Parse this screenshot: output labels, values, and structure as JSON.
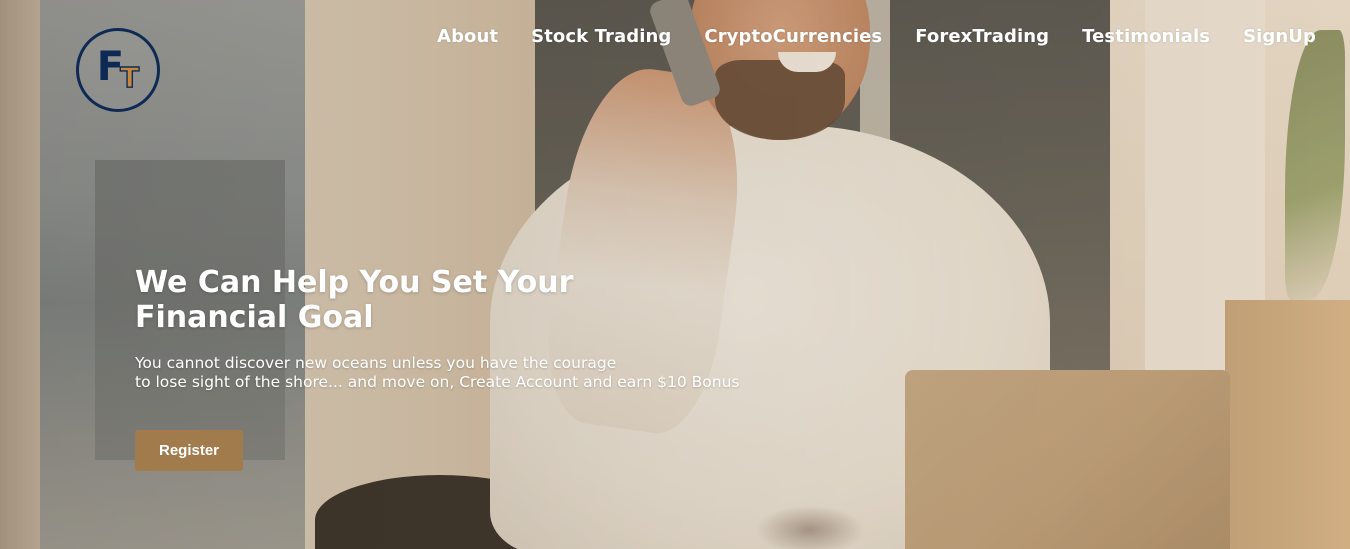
{
  "logo": {
    "letter_primary": "F",
    "letter_secondary": "T",
    "primary_color": "#0e2a54",
    "secondary_color": "#c8873f"
  },
  "nav": {
    "items": [
      {
        "label": "About"
      },
      {
        "label": "Stock Trading"
      },
      {
        "label": "CryptoCurrencies"
      },
      {
        "label": "ForexTrading"
      },
      {
        "label": "Testimonials"
      },
      {
        "label": "SignUp"
      }
    ]
  },
  "hero": {
    "headline_line1": "We Can Help You Set Your",
    "headline_line2": "Financial Goal",
    "subtext_line1": "You cannot discover new oceans unless you have the courage",
    "subtext_line2": "to lose sight of the shore... and move on, Create Account and earn $10 Bonus",
    "register_label": "Register",
    "button_color": "#a27b4d",
    "background_image": "man-on-phone-smiling-photo"
  }
}
